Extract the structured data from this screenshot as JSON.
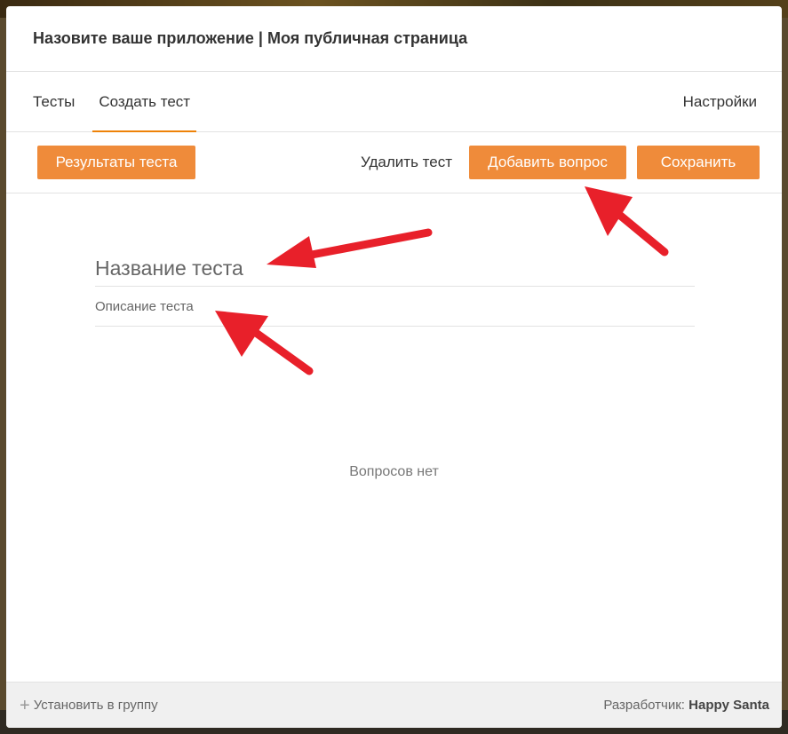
{
  "app": {
    "title": "Назовите ваше приложение | Моя публичная страница"
  },
  "tabs": [
    {
      "label": "Тесты",
      "active": false
    },
    {
      "label": "Создать тест",
      "active": true
    },
    {
      "label": "Настройки",
      "active": false
    }
  ],
  "toolbar": {
    "results_label": "Результаты теста",
    "delete_label": "Удалить тест",
    "add_question_label": "Добавить вопрос",
    "save_label": "Сохранить"
  },
  "form": {
    "title_placeholder": "Название теста",
    "description_placeholder": "Описание теста"
  },
  "empty_state": "Вопросов нет",
  "footer": {
    "install_label": "Установить в группу",
    "developer_prefix": "Разработчик:",
    "developer_name": "Happy Santa"
  },
  "colors": {
    "accent": "#ee8208",
    "button": "#ef8b3a",
    "annotation_arrow": "#e8202a"
  },
  "icons": {
    "plus": "plus-icon",
    "arrows": "red-arrow-icon"
  }
}
